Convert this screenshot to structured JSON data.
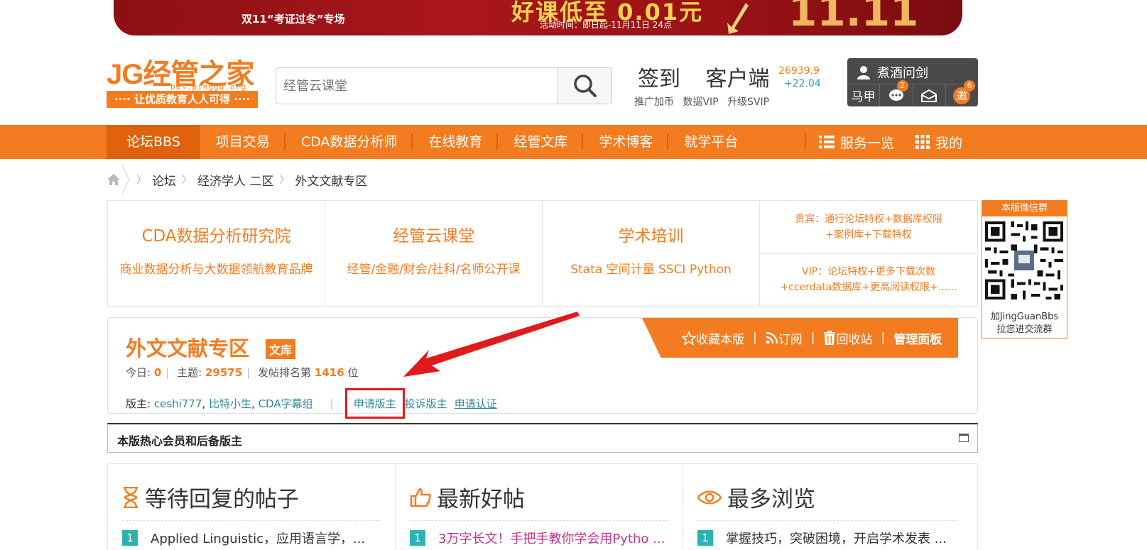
{
  "banner": {
    "left_text": "双11“考证过冬”专场",
    "headline": "好课低至 0.01元",
    "activity_time": "活动时间：即日起-11月11日 24点",
    "big_date": "11.11"
  },
  "logo": {
    "main": "JG经管之家",
    "url": "bbs.pinggu.org",
    "slogan": "···· 让优质教育人人可得 ····"
  },
  "search": {
    "placeholder": "经管云课堂"
  },
  "header": {
    "sign_in": "签到",
    "client": "客户端",
    "promo_coin": "推广加币",
    "data_vip": "数据VIP",
    "upgrade_svip": "升级SVIP",
    "stat_value": "26939.9",
    "stat_delta": "+22.04"
  },
  "user": {
    "name": "煮酒问剑",
    "horse": "马甲",
    "msg_count": "2",
    "invite_label": "邀",
    "invite_count": "6"
  },
  "nav": {
    "items": [
      "论坛BBS",
      "项目交易",
      "CDA数据分析师",
      "在线教育",
      "经管文库",
      "学术博客",
      "就学平台"
    ],
    "services": "服务一览",
    "mine": "我的"
  },
  "breadcrumb": [
    "论坛",
    "经济学人 二区",
    "外文文献专区"
  ],
  "promo": [
    {
      "title": "CDA数据分析研究院",
      "desc": "商业数据分析与大数据领航教育品牌"
    },
    {
      "title": "经管云课堂",
      "desc": "经管/金融/财会/社科/名师公开课"
    },
    {
      "title": "学术培训",
      "desc": "Stata 空间计量 SSCI Python"
    }
  ],
  "promo_right": {
    "guest_line1": "贵宾：通行论坛特权+数据库权限",
    "guest_line2": "+案例库+下载特权",
    "vip_line1": "VIP：论坛特权+更多下载次数",
    "vip_line2": "+ccerdata数据库+更高阅读权限+......"
  },
  "qr": {
    "title": "本版微信群",
    "line1": "加JingGuanBbs",
    "line2": "拉您进交流群"
  },
  "forum": {
    "title": "外文文献专区",
    "tag": "文库",
    "today_label": "今日:",
    "today": "0",
    "topics_label": "主题:",
    "topics": "29575",
    "rank_label": "发帖排名第",
    "rank": "1416",
    "rank_unit": "位",
    "mods_label": "版主:",
    "mods": [
      "ceshi777",
      "比特小生",
      "CDA字幕组"
    ],
    "apply_mod": "申请版主",
    "complain_mod": "投诉版主",
    "apply_cert": "申请认证",
    "toolbar": {
      "fav": "收藏本版",
      "subscribe": "订阅",
      "recycle": "回收站",
      "admin": "管理面板"
    }
  },
  "hot_members": {
    "title": "本版热心会员和后备版主"
  },
  "lists": [
    {
      "title": "等待回复的帖子",
      "items": [
        {
          "n": "1",
          "text": "Applied Linguistic，应用语言学，..."
        }
      ]
    },
    {
      "title": "最新好帖",
      "items": [
        {
          "n": "1",
          "text": "3万字长文！手把手教你学会用Pytho ..."
        }
      ]
    },
    {
      "title": "最多浏览",
      "items": [
        {
          "n": "1",
          "text": "掌握技巧，突破困境，开启学术发表 ..."
        }
      ]
    }
  ],
  "colors": {
    "accent": "#f47c20",
    "teal": "#2bb3b3",
    "highlight": "#e01b1b"
  }
}
